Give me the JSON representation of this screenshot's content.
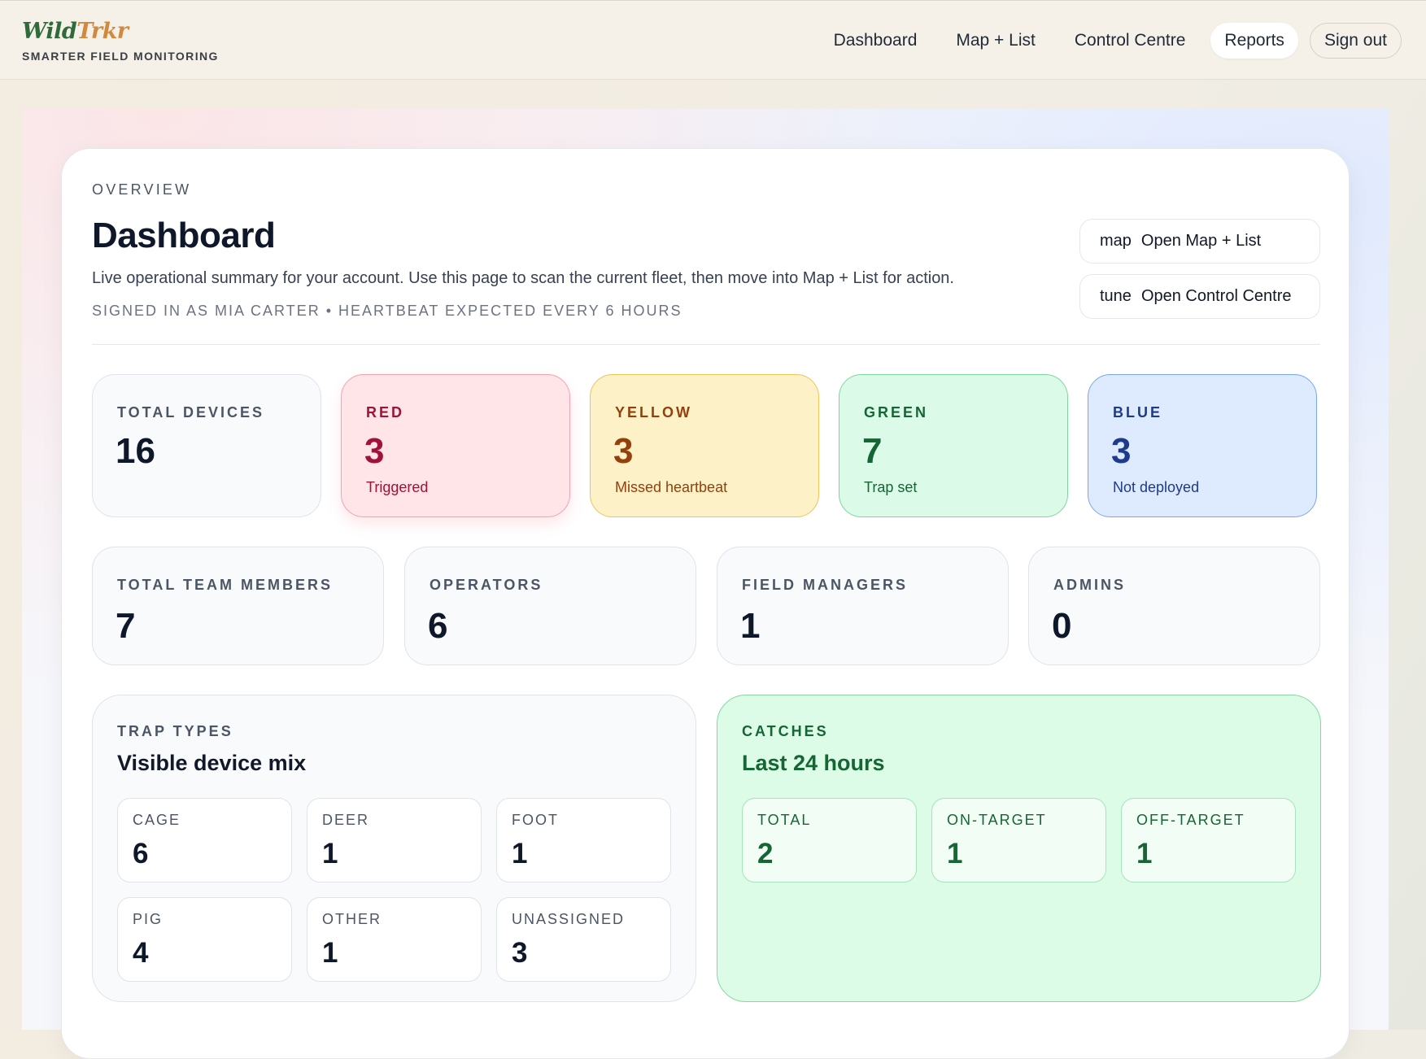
{
  "brand": {
    "logo_part1": "Wild",
    "logo_part2": "Trkr",
    "tagline": "SMARTER FIELD MONITORING"
  },
  "nav": {
    "items": [
      {
        "label": "Dashboard"
      },
      {
        "label": "Map + List"
      },
      {
        "label": "Control Centre"
      },
      {
        "label": "Reports"
      }
    ],
    "active": "Reports",
    "sign_out": "Sign out"
  },
  "header": {
    "eyebrow": "Overview",
    "title": "Dashboard",
    "description": "Live operational summary for your account. Use this page to scan the current fleet, then move into Map + List for action.",
    "meta": "SIGNED IN AS MIA CARTER • HEARTBEAT EXPECTED EVERY 6 HOURS"
  },
  "quick_actions": [
    {
      "icon": "map",
      "label": "Open Map + List"
    },
    {
      "icon": "tune",
      "label": "Open Control Centre"
    }
  ],
  "device_status": {
    "total": {
      "label": "Total devices",
      "value": "16"
    },
    "red": {
      "label": "Red",
      "value": "3",
      "sub": "Triggered",
      "color": "#9f1239"
    },
    "yellow": {
      "label": "Yellow",
      "value": "3",
      "sub": "Missed heartbeat",
      "color": "#92400e"
    },
    "green": {
      "label": "Green",
      "value": "7",
      "sub": "Trap set",
      "color": "#166534"
    },
    "blue": {
      "label": "Blue",
      "value": "3",
      "sub": "Not deployed",
      "color": "#1e3a8a"
    }
  },
  "team": {
    "total": {
      "label": "Total team members",
      "value": "7"
    },
    "operators": {
      "label": "Operators",
      "value": "6"
    },
    "field_managers": {
      "label": "Field managers",
      "value": "1"
    },
    "admins": {
      "label": "Admins",
      "value": "0"
    }
  },
  "trap_types": {
    "eyebrow": "Trap types",
    "title": "Visible device mix",
    "items": [
      {
        "label": "Cage",
        "value": "6"
      },
      {
        "label": "Deer",
        "value": "1"
      },
      {
        "label": "Foot",
        "value": "1"
      },
      {
        "label": "Pig",
        "value": "4"
      },
      {
        "label": "Other",
        "value": "1"
      },
      {
        "label": "Unassigned",
        "value": "3"
      }
    ]
  },
  "catches": {
    "eyebrow": "Catches",
    "title": "Last 24 hours",
    "items": [
      {
        "label": "Total",
        "value": "2"
      },
      {
        "label": "On-target",
        "value": "1"
      },
      {
        "label": "Off-target",
        "value": "1"
      }
    ]
  }
}
